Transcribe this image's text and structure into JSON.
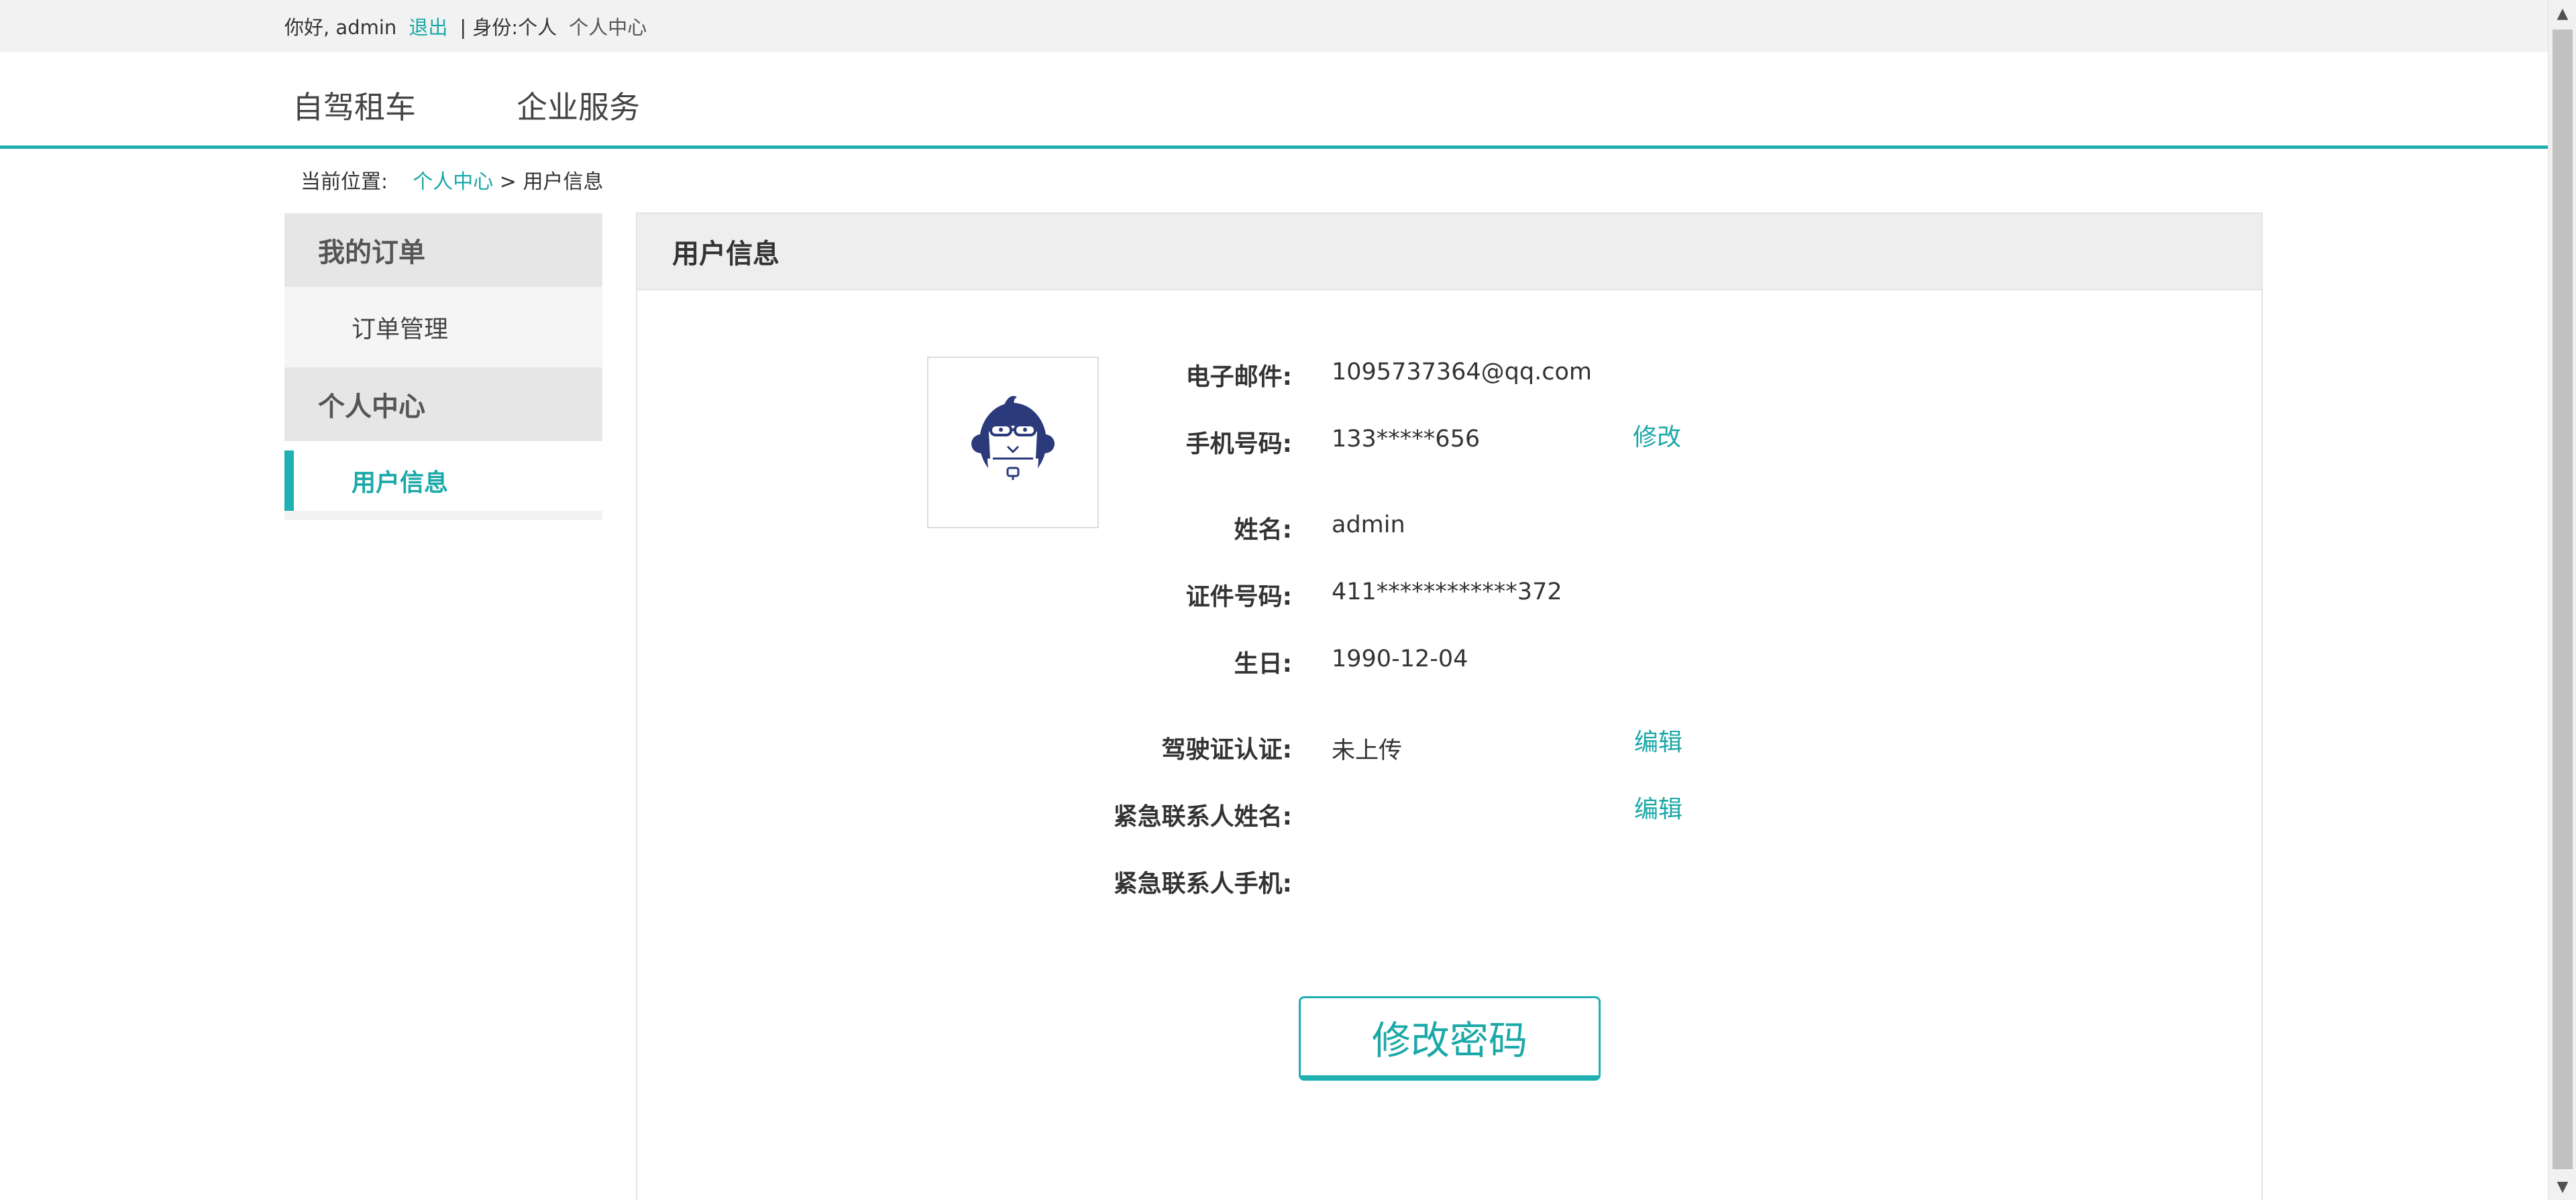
{
  "topbar": {
    "greeting": "你好, admin",
    "logout": "退出",
    "identity": "| 身份:个人",
    "center_link": "个人中心"
  },
  "nav": {
    "items": [
      {
        "label": "自驾租车"
      },
      {
        "label": "企业服务"
      }
    ]
  },
  "breadcrumb": {
    "prefix": "当前位置:",
    "parent": "个人中心",
    "separator": ">",
    "current": "用户信息"
  },
  "sidebar": {
    "groups": [
      {
        "title": "我的订单",
        "items": [
          {
            "label": "订单管理"
          }
        ]
      },
      {
        "title": "个人中心",
        "items": [
          {
            "label": "用户信息"
          }
        ]
      }
    ]
  },
  "panel": {
    "title": "用户信息",
    "avatar_icon": "gorilla-avatar-icon",
    "fields": [
      {
        "label": "电子邮件:",
        "value": "1095737364@qq.com"
      },
      {
        "label": "手机号码:",
        "value": "133*****656",
        "action": "修改"
      },
      {
        "label": "姓名:",
        "value": "admin"
      },
      {
        "label": "证件号码:",
        "value": "411************372"
      },
      {
        "label": "生日:",
        "value": "1990-12-04"
      },
      {
        "label": "驾驶证认证:",
        "value": "未上传",
        "action": "编辑"
      },
      {
        "label": "紧急联系人姓名:",
        "value": "",
        "action": "编辑"
      },
      {
        "label": "紧急联系人手机:",
        "value": ""
      }
    ],
    "password_button": "修改密码"
  },
  "colors": {
    "accent": "#1fb1b1",
    "link": "#1ba8a8",
    "avatar_navy": "#2a3a7a"
  }
}
